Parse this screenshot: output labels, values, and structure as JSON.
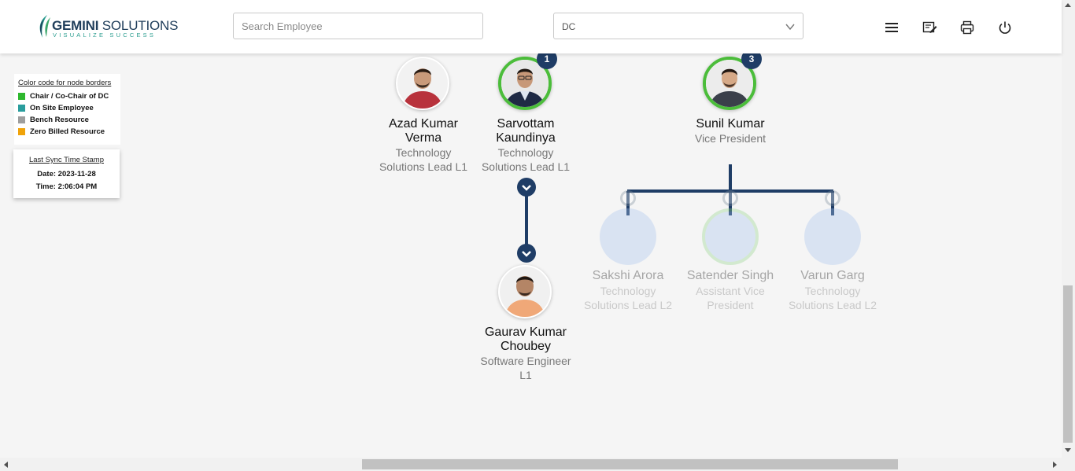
{
  "header": {
    "logo": {
      "brand_bold": "GEMINI",
      "brand_light": " SOLUTIONS",
      "tagline": "VISUALIZE SUCCESS"
    },
    "search": {
      "placeholder": "Search Employee",
      "value": ""
    },
    "dc_select": {
      "value": "DC"
    },
    "actions": [
      {
        "icon": "menu-icon"
      },
      {
        "icon": "edit-note-icon"
      },
      {
        "icon": "print-icon"
      },
      {
        "icon": "power-icon"
      }
    ]
  },
  "legend": {
    "title": "Color code for node borders",
    "items": [
      {
        "label": "Chair / Co-Chair of DC",
        "color": "#2eb82e"
      },
      {
        "label": "On Site Employee",
        "color": "#2a9d9d"
      },
      {
        "label": "Bench Resource",
        "color": "#9e9e9e"
      },
      {
        "label": "Zero Billed Resource",
        "color": "#f0a30a"
      }
    ]
  },
  "sync": {
    "title": "Last Sync Time Stamp",
    "date": "Date: 2023-11-28",
    "time": "Time: 2:06:04 PM"
  },
  "nodes": {
    "azad": {
      "name": "Azad Kumar Verma",
      "role": "Technology Solutions Lead L1"
    },
    "sarvottam": {
      "name": "Sarvottam Kaundinya",
      "role": "Technology Solutions Lead L1",
      "count": "1"
    },
    "sunil": {
      "name": "Sunil Kumar",
      "role": "Vice President",
      "count": "3"
    },
    "gaurav": {
      "name": "Gaurav Kumar Choubey",
      "role": "Software Engineer L1"
    },
    "sakshi": {
      "name": "Sakshi Arora",
      "role": "Technology Solutions Lead L2"
    },
    "satender": {
      "name": "Satender Singh",
      "role": "Assistant Vice President"
    },
    "varun": {
      "name": "Varun Garg",
      "role": "Technology Solutions Lead L2"
    }
  },
  "colors": {
    "chair_border": "#4bbd3a",
    "connector": "#1f3d66",
    "brand": "#1f3d5a"
  }
}
